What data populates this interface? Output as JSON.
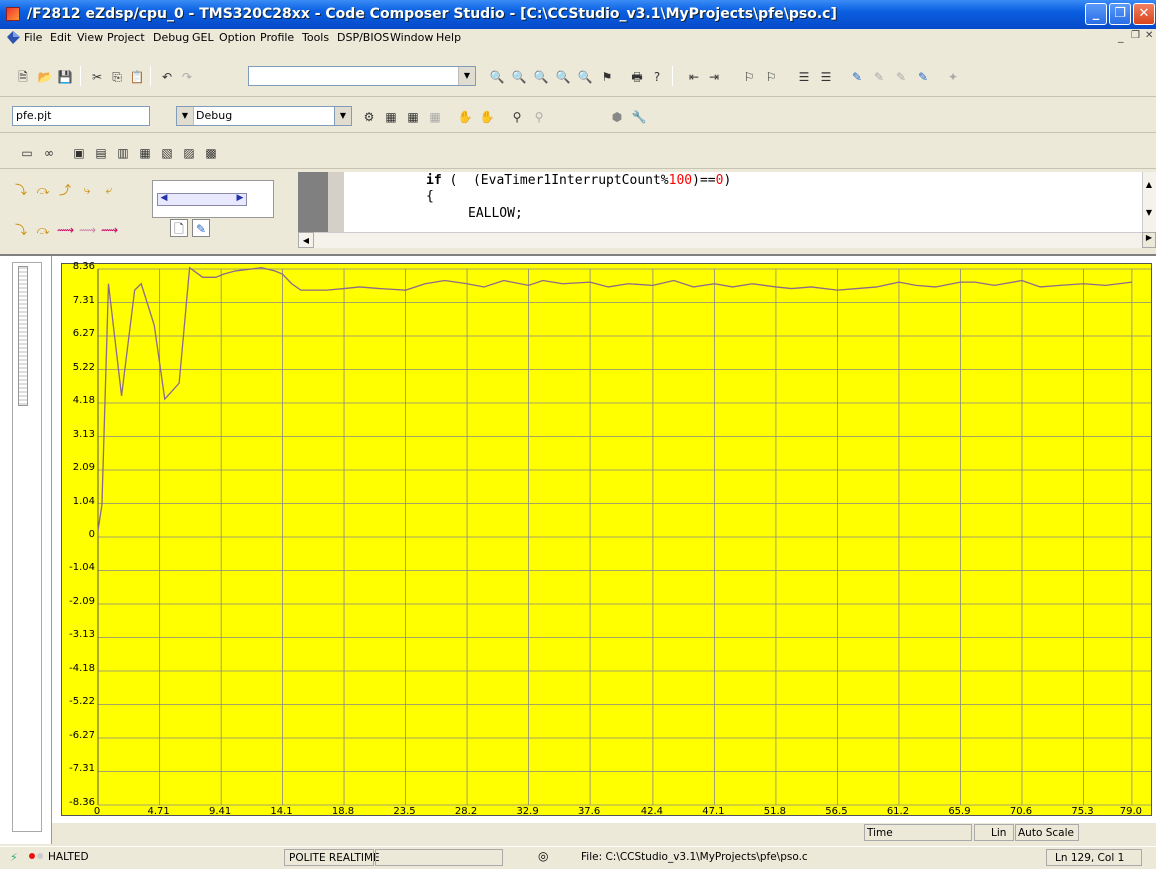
{
  "window": {
    "title": "/F2812 eZdsp/cpu_0 - TMS320C28xx - Code Composer Studio - [C:\\CCStudio_v3.1\\MyProjects\\pfe\\pso.c]"
  },
  "menubar": {
    "items": [
      "File",
      "Edit",
      "View",
      "Project",
      "Debug",
      "GEL",
      "Option",
      "Profile",
      "Tools",
      "DSP/BIOS",
      "Window",
      "Help"
    ]
  },
  "toolbar": {
    "project_combo": "pfe.pjt",
    "config_combo": "Debug",
    "find_combo": ""
  },
  "code": {
    "line1": {
      "kw": "if",
      "pre": " (  (EvaTimer1InterruptCount%",
      "num": "100",
      "post": ")==",
      "num2": "0",
      ")": ")"
    },
    "line2": "{",
    "line3": "EALLOW;"
  },
  "graph": {
    "x_axis_label": "Time",
    "scale_type": "Lin",
    "scale_mode": "Auto Scale",
    "bg_color": "#ffff00",
    "line_color": "#8b6a8b"
  },
  "chart_data": {
    "type": "line",
    "ylim": [
      -8.36,
      8.36
    ],
    "xlim": [
      0,
      80
    ],
    "y_ticks": [
      "8.36",
      "7.31",
      "6.27",
      "5.22",
      "4.18",
      "3.13",
      "2.09",
      "1.04",
      "0",
      "-1.04",
      "-2.09",
      "-3.13",
      "-4.18",
      "-5.22",
      "-6.27",
      "-7.31",
      "-8.36"
    ],
    "x_ticks": [
      "0",
      "4.71",
      "9.41",
      "14.1",
      "18.8",
      "23.5",
      "28.2",
      "32.9",
      "37.6",
      "42.4",
      "47.1",
      "51.8",
      "56.5",
      "61.2",
      "65.9",
      "70.6",
      "75.3",
      "79.0"
    ],
    "series": [
      {
        "x": [
          0,
          0.3,
          0.8,
          1.8,
          2.8,
          3.3,
          4.3,
          5.1,
          6.2,
          7.0,
          8.0,
          9.0,
          9.6,
          10.5,
          11.5,
          12.5,
          13.5,
          14.1,
          14.8,
          15.5,
          16.5,
          17.5,
          18.8,
          20,
          21.5,
          23.5,
          25,
          26.5,
          28.2,
          29.5,
          31,
          32.9,
          34,
          35.5,
          37.6,
          39,
          40.5,
          42.4,
          44,
          45.5,
          47.1,
          48.5,
          50,
          51.8,
          53,
          54.5,
          56.5,
          58,
          59.5,
          61.2,
          62.5,
          64,
          65.9,
          67,
          68.5,
          70.6,
          72,
          73.5,
          75.3,
          77,
          79.0
        ],
        "y": [
          0.2,
          1.0,
          7.9,
          4.4,
          7.7,
          7.9,
          6.6,
          4.3,
          4.8,
          8.4,
          8.1,
          8.1,
          8.2,
          8.3,
          8.35,
          8.4,
          8.3,
          8.2,
          7.9,
          7.7,
          7.7,
          7.7,
          7.75,
          7.8,
          7.75,
          7.7,
          7.9,
          8.0,
          7.9,
          7.8,
          8.0,
          7.85,
          8.0,
          7.9,
          7.95,
          7.8,
          7.9,
          7.85,
          8.0,
          7.8,
          7.9,
          7.8,
          7.9,
          7.8,
          7.75,
          7.8,
          7.7,
          7.75,
          7.8,
          7.95,
          7.85,
          7.8,
          7.95,
          7.95,
          7.85,
          8.0,
          7.8,
          7.85,
          7.9,
          7.85,
          7.95
        ]
      }
    ]
  },
  "status": {
    "state": "HALTED",
    "mode": "POLITE REALTIME",
    "file": "File: C:\\CCStudio_v3.1\\MyProjects\\pfe\\pso.c",
    "cursor": "Ln 129, Col 1"
  }
}
